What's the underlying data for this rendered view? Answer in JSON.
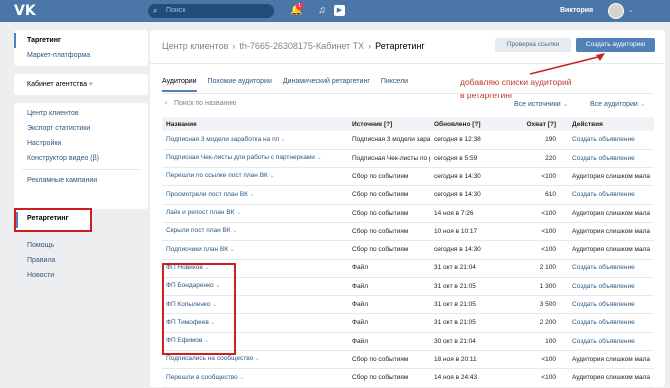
{
  "topbar": {
    "logo": "VK",
    "search_placeholder": "Поиск",
    "bell_badge": "1",
    "user_name": "Виктория"
  },
  "leftnav": {
    "group1": [
      "Таргетинг",
      "Маркет-платформа"
    ],
    "agency": "Кабинет агентства",
    "group2": [
      "Центр клиентов",
      "Экспорт статистики",
      "Настройки",
      "Конструктор видео (β)",
      "Рекламные кампании"
    ],
    "retargeting": "Ретаргетинг",
    "footer": [
      "Помощь",
      "Правила",
      "Новости"
    ]
  },
  "breadcrumb": {
    "client_center": "Центр клиентов",
    "cabinet": "th-7665-26308175-Кабинет ТХ",
    "current": "Ретаргетинг"
  },
  "buttons": {
    "check_link": "Проверка ссылки",
    "create_audience": "Создать аудиторию"
  },
  "annotation": {
    "line1": "добавляю списки аудиторий",
    "line2": "в ретаргетинг"
  },
  "tabs": [
    "Аудитории",
    "Похожие аудитории",
    "Динамический ретаргетинг",
    "Пиксели"
  ],
  "filters": {
    "search_placeholder": "Поиск по названию",
    "sources": "Все источники",
    "audiences": "Все аудитории"
  },
  "table": {
    "headers": [
      "Название",
      "Источник [?]",
      "Обновлено [?]",
      "Охват [?]",
      "Действия"
    ],
    "rows": [
      {
        "name": "Подписная 3 модели заработка на пп",
        "source": "Подписная 3 модели заработка на пп",
        "updated": "сегодня в 12:38",
        "coverage": "190",
        "action": "Создать объявление"
      },
      {
        "name": "Подписная Чек-листы для работы с партнерками",
        "source": "Подписная Чек-листы по работе с партнерками",
        "updated": "сегодня в 5:59",
        "coverage": "220",
        "action": "Создать объявление"
      },
      {
        "name": "Перешли по ссылке пост план ВК",
        "source": "Сбор по событиям",
        "updated": "сегодня в 14:30",
        "coverage": "<100",
        "action": "Аудитория слишком мала"
      },
      {
        "name": "Просмотрели пост план ВК",
        "source": "Сбор по событиям",
        "updated": "сегодня в 14:30",
        "coverage": "610",
        "action": "Создать объявление"
      },
      {
        "name": "Лайк и репост план ВК",
        "source": "Сбор по событиям",
        "updated": "14 ноя в 7:26",
        "coverage": "<100",
        "action": "Аудитория слишком мала"
      },
      {
        "name": "Скрыли пост план ВК",
        "source": "Сбор по событиям",
        "updated": "10 ноя в 10:17",
        "coverage": "<100",
        "action": "Аудитория слишком мала"
      },
      {
        "name": "Подписчики план ВК",
        "source": "Сбор по событиям",
        "updated": "сегодня в 14:30",
        "coverage": "<100",
        "action": "Аудитория слишком мала"
      },
      {
        "name": "ФП Новиков",
        "source": "Файл",
        "updated": "31 окт в 21:04",
        "coverage": "2 100",
        "action": "Создать объявление"
      },
      {
        "name": "ФП Бондаренко",
        "source": "Файл",
        "updated": "31 окт в 21:05",
        "coverage": "1 300",
        "action": "Создать объявление"
      },
      {
        "name": "ФП Копыленко",
        "source": "Файл",
        "updated": "31 окт в 21:05",
        "coverage": "3 500",
        "action": "Создать объявление"
      },
      {
        "name": "ФП Тимофеев",
        "source": "Файл",
        "updated": "31 окт в 21:05",
        "coverage": "2 200",
        "action": "Создать объявление"
      },
      {
        "name": "ФП Ефимов",
        "source": "Файл",
        "updated": "30 окт в 21:04",
        "coverage": "100",
        "action": "Создать объявление"
      },
      {
        "name": "Подписались на сообщество",
        "source": "Сбор по событиям",
        "updated": "18 ноя в 20:11",
        "coverage": "<100",
        "action": "Аудитория слишком мала"
      },
      {
        "name": "Перешли в сообщество",
        "source": "Сбор по событиям",
        "updated": "14 ноя в 24:43",
        "coverage": "<100",
        "action": "Аудитория слишком мала"
      }
    ]
  }
}
